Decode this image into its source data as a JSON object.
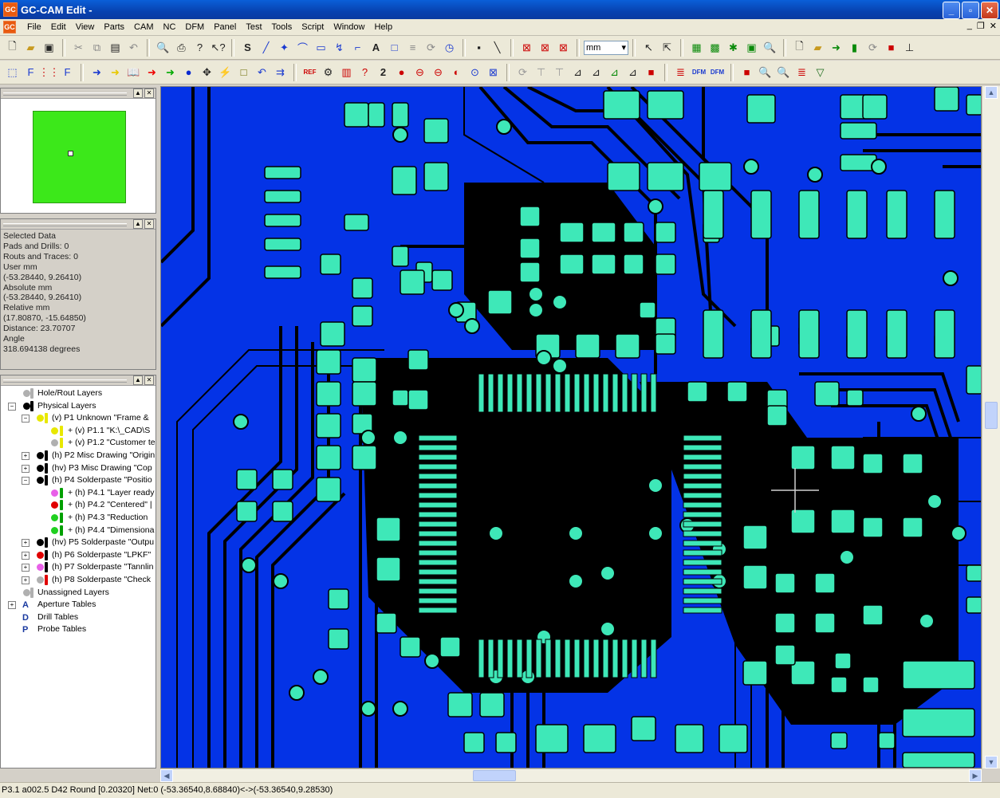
{
  "window": {
    "title": "GC-CAM Edit -",
    "icon": "GC"
  },
  "menu": [
    "File",
    "Edit",
    "View",
    "Parts",
    "CAM",
    "NC",
    "DFM",
    "Panel",
    "Test",
    "Tools",
    "Script",
    "Window",
    "Help"
  ],
  "toolbar": {
    "units_value": "mm"
  },
  "info_panel": {
    "lines": [
      "Selected Data",
      "Pads and Drills: 0",
      "Routs and Traces: 0",
      "User mm",
      "(-53.28440,  9.26410)",
      "Absolute mm",
      "(-53.28440,  9.26410)",
      "Relative mm",
      "(17.80870, -15.64850)",
      "Distance: 23.70707",
      "Angle",
      "318.694138 degrees"
    ]
  },
  "tree": {
    "items": [
      {
        "label": "Hole/Rout Layers",
        "dot": "#b0b0b0",
        "bar": "#b0b0b0"
      },
      {
        "label": "Physical Layers",
        "dot": "#000000",
        "bar": "#000000"
      },
      {
        "label": "(v) P1 Unknown \"Frame &",
        "dot": "#e8e800",
        "bar": "#e8e800"
      },
      {
        "label": "+ (v) P1.1 \"K:\\_CAD\\S",
        "dot": "#e8e800",
        "bar": "#e8e800"
      },
      {
        "label": "+ (v) P1.2 \"Customer te",
        "dot": "#b0b0b0",
        "bar": "#e8e800"
      },
      {
        "label": "(h) P2 Misc Drawing \"Origin",
        "dot": "#000000",
        "bar": "#000000"
      },
      {
        "label": "(hv) P3 Misc Drawing \"Cop",
        "dot": "#000000",
        "bar": "#000000"
      },
      {
        "label": "(h) P4 Solderpaste \"Positio",
        "dot": "#000000",
        "bar": "#000000"
      },
      {
        "label": "+ (h) P4.1 \"Layer ready",
        "dot": "#e860e8",
        "bar": "#00a000"
      },
      {
        "label": "+ (h) P4.2 \"Centered\" |",
        "dot": "#e00000",
        "bar": "#00a000"
      },
      {
        "label": "+ (h) P4.3 \"Reduction",
        "dot": "#20d020",
        "bar": "#00a000"
      },
      {
        "label": "+ (h) P4.4 \"Dimensiona",
        "dot": "#20d020",
        "bar": "#00a000"
      },
      {
        "label": "(hv) P5 Solderpaste \"Outpu",
        "dot": "#000000",
        "bar": "#000000"
      },
      {
        "label": "(h) P6 Solderpaste \"LPKF\"",
        "dot": "#e00000",
        "bar": "#000000"
      },
      {
        "label": "(h) P7 Solderpaste \"Tannlin",
        "dot": "#e860e8",
        "bar": "#000000"
      },
      {
        "label": "(h) P8 Solderpaste \"Check",
        "dot": "#b0b0b0",
        "bar": "#e00000"
      },
      {
        "label": "Unassigned Layers",
        "dot": "#b0b0b0",
        "bar": "#b0b0b0"
      },
      {
        "label": "Aperture Tables",
        "dot": "",
        "bar": ""
      },
      {
        "label": "Drill Tables",
        "dot": "",
        "bar": ""
      },
      {
        "label": "Probe Tables",
        "dot": "",
        "bar": ""
      }
    ]
  },
  "status_bar": {
    "text": "P3.1 a002.5 D42 Round [0.20320] Net:0 (-53.36540,8.68840)<->(-53.36540,9.28530)"
  },
  "colors": {
    "board_background": "#0433e6",
    "copper_trace": "#000000",
    "pad": "#3ee8b8",
    "preview_board": "#3ce81a"
  }
}
